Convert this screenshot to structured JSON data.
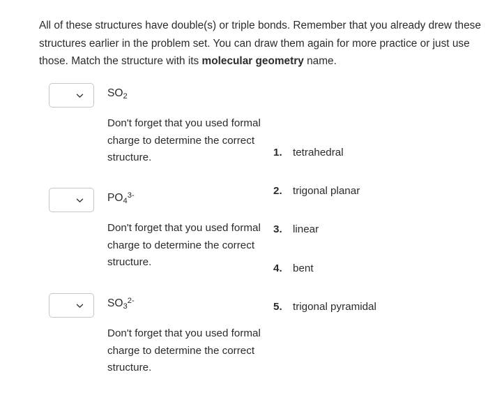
{
  "instructions": {
    "text_before_bold": "All of these structures have double(s) or triple bonds.  Remember that you already drew these structures earlier in the problem set.  You can draw them again for more practice or just use those.  Match the structure with its ",
    "bold_phrase": "molecular geometry",
    "text_after_bold": " name."
  },
  "questions": [
    {
      "formula_base1": "SO",
      "formula_sub1": "2",
      "formula_sup1": "",
      "dropdown_value": "",
      "dropdown_icon": "chevron-down-icon",
      "hint": "Don't forget that you used formal charge to determine the correct structure."
    },
    {
      "formula_base1": "PO",
      "formula_sub1": "4",
      "formula_sup1": "3-",
      "dropdown_value": "",
      "dropdown_icon": "chevron-down-icon",
      "hint": "Don't forget that you used formal charge to determine the correct structure."
    },
    {
      "formula_base1": "SO",
      "formula_sub1": "3",
      "formula_sup1": "2-",
      "dropdown_value": "",
      "dropdown_icon": "chevron-down-icon",
      "hint": "Don't forget that you used formal charge to determine the correct structure."
    }
  ],
  "options": [
    {
      "number": "1.",
      "label": "tetrahedral"
    },
    {
      "number": "2.",
      "label": "trigonal planar"
    },
    {
      "number": "3.",
      "label": "linear"
    },
    {
      "number": "4.",
      "label": "bent"
    },
    {
      "number": "5.",
      "label": "trigonal pyramidal"
    }
  ],
  "colors": {
    "text": "#2b2b2b",
    "border": "#c6c6c6",
    "background": "#ffffff"
  }
}
